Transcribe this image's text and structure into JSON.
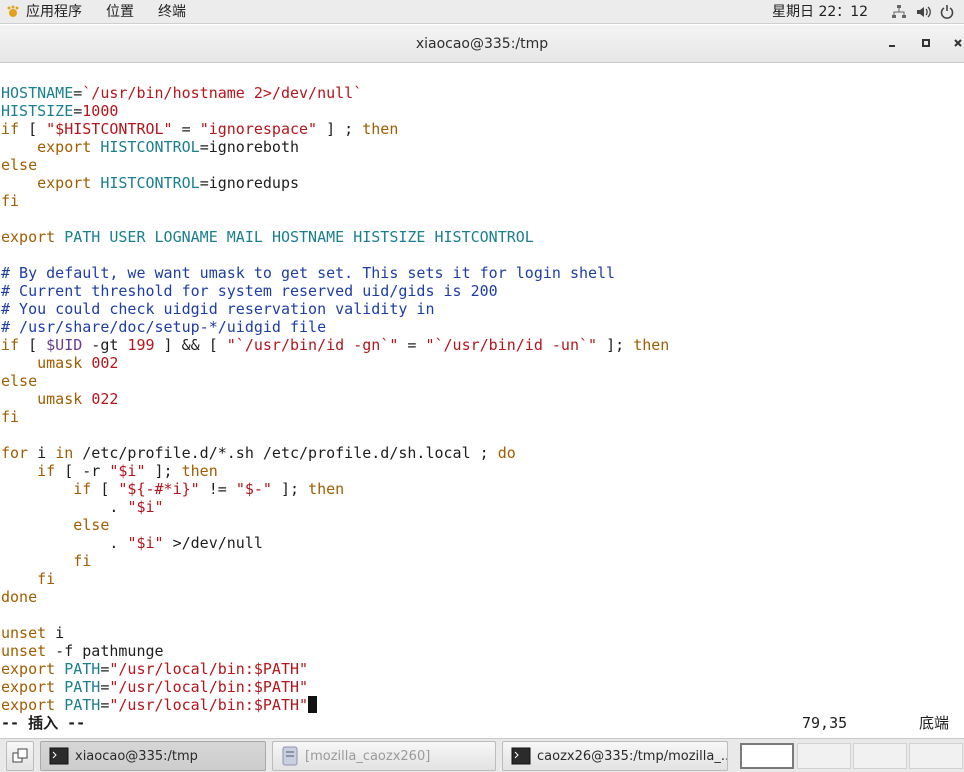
{
  "topbar": {
    "applications": "应用程序",
    "places": "位置",
    "terminal": "终端",
    "clock": "星期日 22：12",
    "tray_icons": [
      "network-icon",
      "volume-icon",
      "power-icon"
    ]
  },
  "window": {
    "title": "xiaocao@335:/tmp",
    "buttons": [
      "minimize-icon",
      "maximize-icon",
      "close-icon"
    ]
  },
  "editor": {
    "lines": [
      "",
      "HOSTNAME=`/usr/bin/hostname 2>/dev/null`",
      "HISTSIZE=1000",
      "if [ \"$HISTCONTROL\" = \"ignorespace\" ] ; then",
      "    export HISTCONTROL=ignoreboth",
      "else",
      "    export HISTCONTROL=ignoredups",
      "fi",
      "",
      "export PATH USER LOGNAME MAIL HOSTNAME HISTSIZE HISTCONTROL",
      "",
      "# By default, we want umask to get set. This sets it for login shell",
      "# Current threshold for system reserved uid/gids is 200",
      "# You could check uidgid reservation validity in",
      "# /usr/share/doc/setup-*/uidgid file",
      "if [ $UID -gt 199 ] && [ \"`/usr/bin/id -gn`\" = \"`/usr/bin/id -un`\" ]; then",
      "    umask 002",
      "else",
      "    umask 022",
      "fi",
      "",
      "for i in /etc/profile.d/*.sh /etc/profile.d/sh.local ; do",
      "    if [ -r \"$i\" ]; then",
      "        if [ \"${-#*i}\" != \"$-\" ]; then",
      "            . \"$i\"",
      "        else",
      "            . \"$i\" >/dev/null",
      "        fi",
      "    fi",
      "done",
      "",
      "unset i",
      "unset -f pathmunge",
      "export PATH=\"/usr/local/bin:$PATH\"",
      "export PATH=\"/usr/local/bin:$PATH\"",
      "export PATH=\"/usr/local/bin:$PATH\""
    ],
    "status_mode": "-- 插入 --",
    "cursor_position": "79,35",
    "scroll_position": "底端"
  },
  "taskbar": {
    "tasks": [
      {
        "label": "xiaocao@335:/tmp",
        "icon": "terminal-icon",
        "active": true
      },
      {
        "label": "[mozilla_caozx260]",
        "icon": "file-manager-icon",
        "active": false
      },
      {
        "label": "caozx26@335:/tmp/mozilla_...",
        "icon": "terminal-icon",
        "active": false
      }
    ],
    "workspaces": 4,
    "active_workspace": 1
  },
  "colors": {
    "variable": "#1a7f8e",
    "keyword": "#a15d00",
    "string": "#b5151b",
    "comment": "#1e3ea7"
  }
}
